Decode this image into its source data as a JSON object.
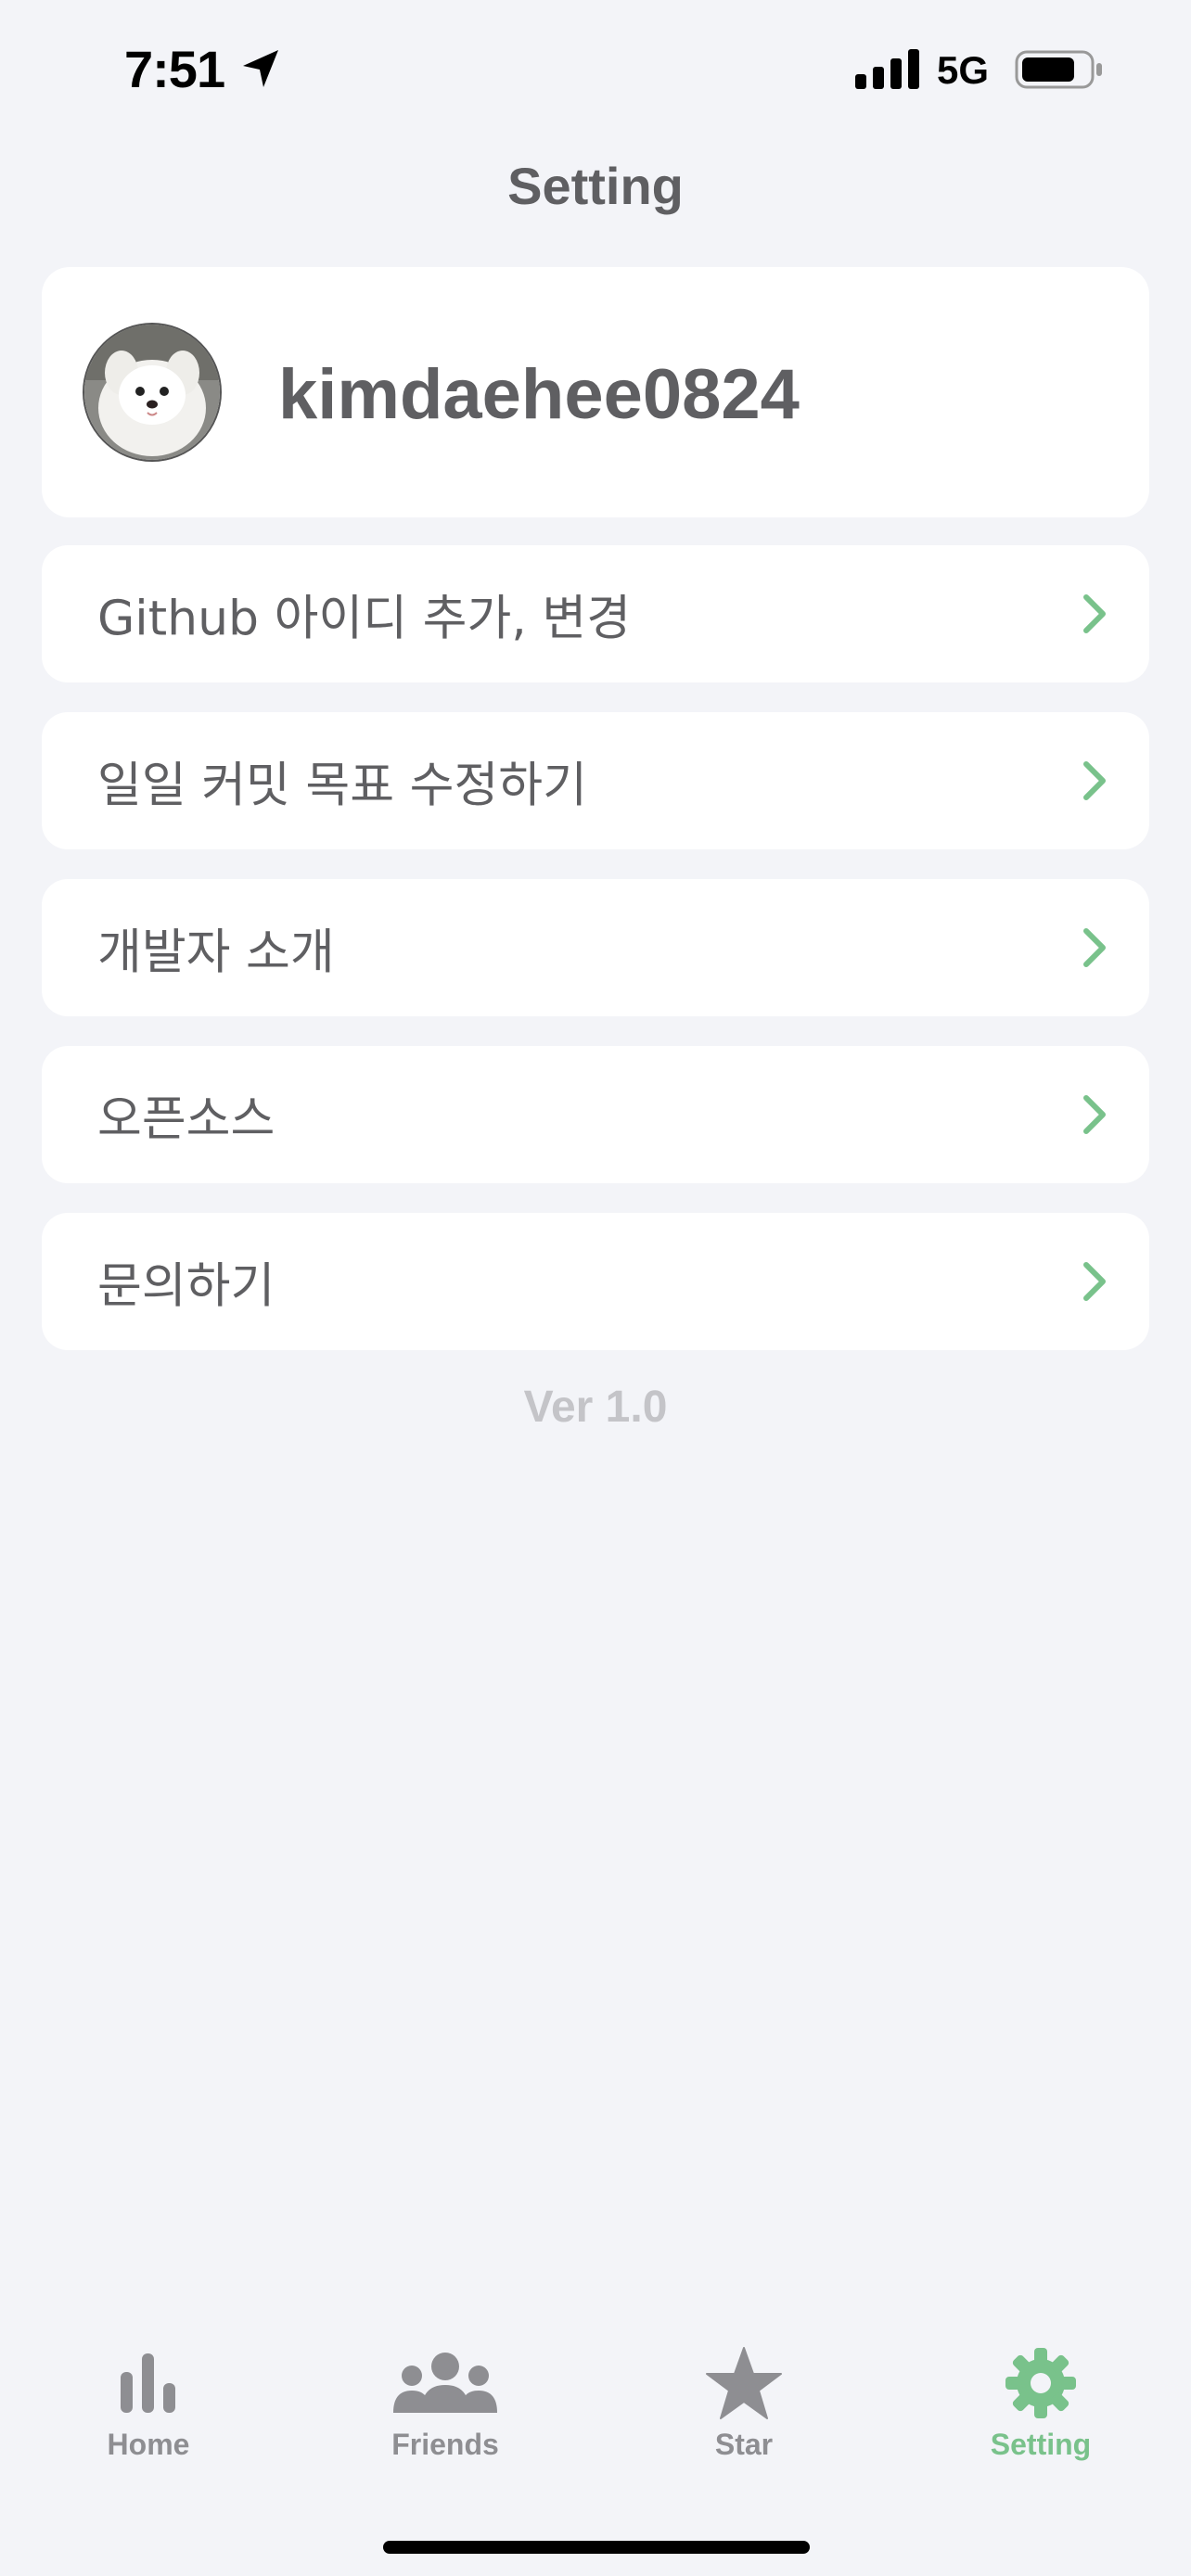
{
  "status_bar": {
    "time": "7:51",
    "network": "5G",
    "icons": [
      "location-arrow-icon",
      "signal-bars-icon",
      "battery-icon"
    ]
  },
  "header": {
    "title": "Setting"
  },
  "profile": {
    "username": "kimdaehee0824",
    "avatar_icon": "dog-avatar"
  },
  "menu": {
    "items": [
      {
        "label": "Github 아이디 추가, 변경",
        "icon": "chevron-right-icon"
      },
      {
        "label": "일일 커밋 목표 수정하기",
        "icon": "chevron-right-icon"
      },
      {
        "label": "개발자 소개",
        "icon": "chevron-right-icon"
      },
      {
        "label": "오픈소스",
        "icon": "chevron-right-icon"
      },
      {
        "label": "문의하기",
        "icon": "chevron-right-icon"
      }
    ]
  },
  "version": "Ver 1.0",
  "tab_bar": {
    "tabs": [
      {
        "label": "Home",
        "icon": "bar-chart-icon",
        "active": false
      },
      {
        "label": "Friends",
        "icon": "people-icon",
        "active": false
      },
      {
        "label": "Star",
        "icon": "star-icon",
        "active": false
      },
      {
        "label": "Setting",
        "icon": "gear-icon",
        "active": true
      }
    ]
  },
  "colors": {
    "background": "#f3f4f8",
    "card": "#ffffff",
    "text": "#5f5f62",
    "accent": "#79c28b",
    "inactive_tab": "#8e8e92",
    "version_text": "#c4c4c8"
  }
}
